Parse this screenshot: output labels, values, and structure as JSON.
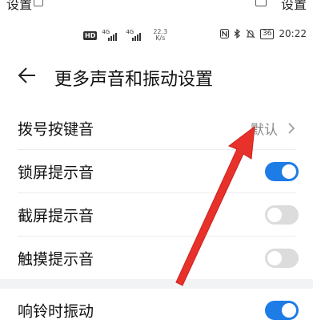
{
  "topcut": {
    "left_text": "设置",
    "right_text": "设置"
  },
  "statusbar": {
    "hd_label": "HD",
    "network1": "4G",
    "network2": "4G",
    "speed_value": "22.3",
    "speed_unit": "K/s",
    "battery": "36",
    "time": "20:22"
  },
  "header": {
    "title": "更多声音和振动设置"
  },
  "rows": [
    {
      "label": "拨号按键音",
      "value": "默认"
    },
    {
      "label": "锁屏提示音",
      "toggle": true
    },
    {
      "label": "截屏提示音",
      "toggle": false
    },
    {
      "label": "触摸提示音",
      "toggle": false
    },
    {
      "label": "响铃时振动",
      "toggle": true
    }
  ],
  "colors": {
    "accent": "#1e7ce6",
    "annotation_arrow": "#e8312b"
  }
}
